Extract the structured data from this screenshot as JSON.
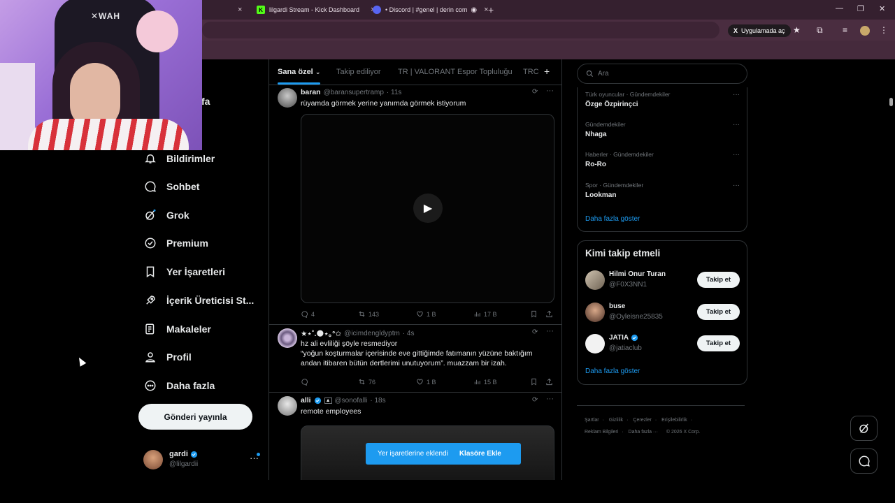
{
  "browser": {
    "tabs": [
      {
        "label": "",
        "close": "×"
      },
      {
        "label": "lilgardi Stream - Kick Dashboard",
        "close": "×"
      },
      {
        "label": "• Discord | #genel | derin com",
        "close": "×"
      }
    ],
    "new_tab": "+",
    "open_in_app": "Uygulamada aç"
  },
  "nav": {
    "partial_label": "fa",
    "items": [
      {
        "label": "Bildirimler",
        "icon": "bell-icon"
      },
      {
        "label": "Sohbet",
        "icon": "chat-icon"
      },
      {
        "label": "Grok",
        "icon": "grok-icon"
      },
      {
        "label": "Premium",
        "icon": "premium-icon"
      },
      {
        "label": "Yer İşaretleri",
        "icon": "bookmark-icon"
      },
      {
        "label": "İçerik Üreticisi St...",
        "icon": "rocket-icon"
      },
      {
        "label": "Makaleler",
        "icon": "articles-icon"
      },
      {
        "label": "Profil",
        "icon": "person-icon"
      },
      {
        "label": "Daha fazla",
        "icon": "more-circle-icon"
      }
    ],
    "post_button": "Gönderi yayınla",
    "account": {
      "name": "gardi",
      "handle": "@lilgardii",
      "more": "···"
    }
  },
  "timeline": {
    "tabs": [
      "Sana özel",
      "Takip ediliyor",
      "TR | VALORANT Espor Topluluğu",
      "TRC"
    ],
    "tab_plus": "+",
    "tweets": [
      {
        "name": "baran",
        "handle": "@baransupertramp",
        "time": "· 11s",
        "text": "rüyamda görmek yerine yanımda görmek istiyorum",
        "replies": "4",
        "reposts": "143",
        "likes": "1 B",
        "views": "17 B"
      },
      {
        "name": "★⋆˚.🌑⋆｡°✩",
        "handle": "@icimdengldyptm",
        "time": "· 4s",
        "text_lines": [
          "hz ali evliliği şöyle resmediyor",
          "“yoğun koşturmalar içerisinde eve gittiğimde fatımanın yüzüne baktığım",
          "andan itibaren bütün dertlerimi unutuyorum”. muazzam bir izah."
        ],
        "replies": "",
        "reposts": "76",
        "likes": "1 B",
        "views": "15 B"
      },
      {
        "name": "alli",
        "handle": "@sonofalli",
        "time": "· 18s",
        "text": "remote employees"
      }
    ],
    "toast": {
      "message": "Yer işaretlerine eklendi",
      "action": "Klasöre Ekle"
    }
  },
  "right": {
    "search_placeholder": "Ara",
    "trends": [
      {
        "meta": "Türk oyuncular · Gündemdekiler",
        "name": "Özge Özpirinçci"
      },
      {
        "meta": "Gündemdekiler",
        "name": "Nhaga"
      },
      {
        "meta": "Haberler · Gündemdekiler",
        "name": "Ro-Ro"
      },
      {
        "meta": "Spor · Gündemdekiler",
        "name": "Lookman"
      }
    ],
    "trends_more": "Daha fazla göster",
    "wtf_title": "Kimi takip etmeli",
    "suggestions": [
      {
        "name": "Hilmi Onur Turan",
        "handle": "@F0X3NN1",
        "verified": false
      },
      {
        "name": "buse",
        "handle": "@Oyleisne25835",
        "verified": false
      },
      {
        "name": "JATIA",
        "handle": "@jatiaclub",
        "verified": true
      }
    ],
    "follow_label": "Takip et",
    "wtf_more": "Daha fazla göster",
    "footer_row1": [
      "Şartlar",
      "Gizlilik",
      "Çerezler",
      "Erişilebilirlik"
    ],
    "footer_row2": [
      "Reklam Bilgileri",
      "Daha fazla ···",
      "© 2026 X Corp."
    ]
  },
  "colors": {
    "accent": "#1d9bf0",
    "background": "#000000",
    "border": "#2f3336",
    "muted": "#71767b"
  }
}
